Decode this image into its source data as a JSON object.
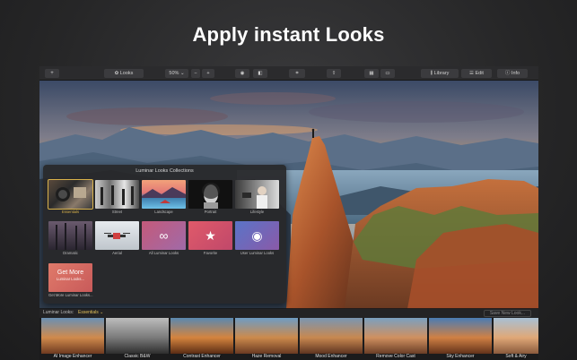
{
  "headline": "Apply instant Looks",
  "toolbar": {
    "add_label": "+",
    "looks_label": "Looks",
    "zoom_value": "50%",
    "zoom_minus": "−",
    "zoom_plus": "+",
    "library_label": "Library",
    "edit_label": "Edit",
    "info_label": "Info"
  },
  "photo": {
    "rating_stars": "★★★★★"
  },
  "collections_panel": {
    "title": "Luminar Looks Collections",
    "tiles": [
      {
        "label": "Essentials",
        "selected": true
      },
      {
        "label": "Street"
      },
      {
        "label": "Landscape"
      },
      {
        "label": "Portrait"
      },
      {
        "label": "Lifestyle"
      },
      {
        "label": "Dramatic"
      },
      {
        "label": "Aerial"
      },
      {
        "label": "All Luminar Looks"
      },
      {
        "label": "Favorite"
      },
      {
        "label": "User Luminar Looks"
      },
      {
        "label": "Get More Luminar Looks...",
        "title": "Get More",
        "subtitle": "Luminar Looks..."
      }
    ]
  },
  "filmstrip": {
    "label": "Luminar Looks:",
    "selected_collection": "Essentials ⌄",
    "save_label": "Save New Look...",
    "looks": [
      "AI Image Enhancer",
      "Classic B&W",
      "Contrast Enhancer",
      "Haze Removal",
      "Mood Enhancer",
      "Remove Color Cast",
      "Sky Enhancer",
      "Soft & Airy"
    ]
  },
  "colors": {
    "accent": "#d9b24a",
    "background": "#262627",
    "panel": "#28282a"
  }
}
